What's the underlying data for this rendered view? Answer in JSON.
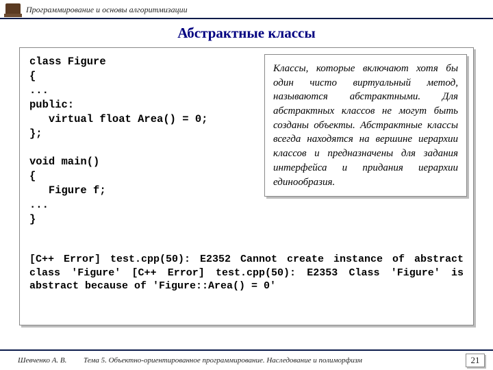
{
  "header": {
    "course": "Программирование и основы алгоритмизации"
  },
  "title": "Абстрактные классы",
  "code": "class Figure\n{\n...\npublic:\n   virtual float Area() = 0;\n};\n\nvoid main()\n{\n   Figure f;\n...\n}",
  "errors": "[C++ Error] test.cpp(50): E2352 Cannot create instance of abstract class 'Figure'\n[C++ Error] test.cpp(50): E2353 Class 'Figure' is abstract because of 'Figure::Area() = 0'",
  "callout": "Классы, которые включают хотя бы один чисто виртуальный метод, называются абстрактными. Для абстрактных классов не могут быть созданы объекты. Абстрактные классы всегда находятся на вершине иерархии классов и предназначены для задания интерфейса и придания иерархии единообразия.",
  "footer": {
    "author": "Шевченко А. В.",
    "topic": "Тема 5. Объектно-ориентированное программирование. Наследование и полиморфизм",
    "page": "21"
  }
}
